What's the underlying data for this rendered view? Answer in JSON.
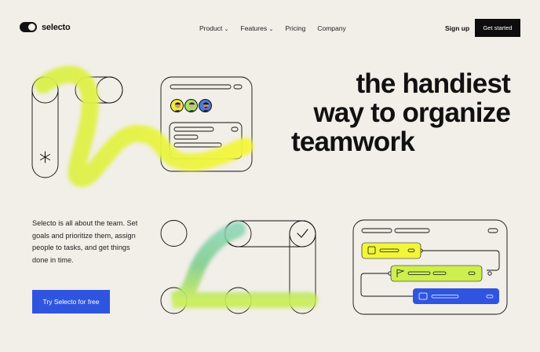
{
  "brand": {
    "name": "selecto"
  },
  "nav": {
    "items": [
      {
        "label": "Product",
        "dropdown": true
      },
      {
        "label": "Features",
        "dropdown": true
      },
      {
        "label": "Pricing",
        "dropdown": false
      },
      {
        "label": "Company",
        "dropdown": false
      }
    ]
  },
  "header": {
    "signup_label": "Sign up",
    "cta_label": "Get started"
  },
  "hero": {
    "headline_lines": [
      "the handiest",
      "way to organize",
      "teamwork"
    ]
  },
  "intro": {
    "description": "Selecto is all about the team. Set goals and prioritize them, assign people to tasks, and get things done in time.",
    "cta_label": "Try Selecto for free"
  },
  "colors": {
    "background": "#f2eee8",
    "dark": "#0d0d0d",
    "accent_blue": "#2f55e0",
    "accent_yellow": "#f1f63a",
    "accent_lime": "#cdef4f",
    "avatar_bgs": [
      "#f1ea3a",
      "#a6e06b",
      "#4a78e0"
    ]
  },
  "icons": [
    "toggle-logo-icon",
    "chevron-down-icon",
    "asterisk-icon",
    "check-icon",
    "document-icon",
    "flag-icon",
    "card-icon"
  ]
}
